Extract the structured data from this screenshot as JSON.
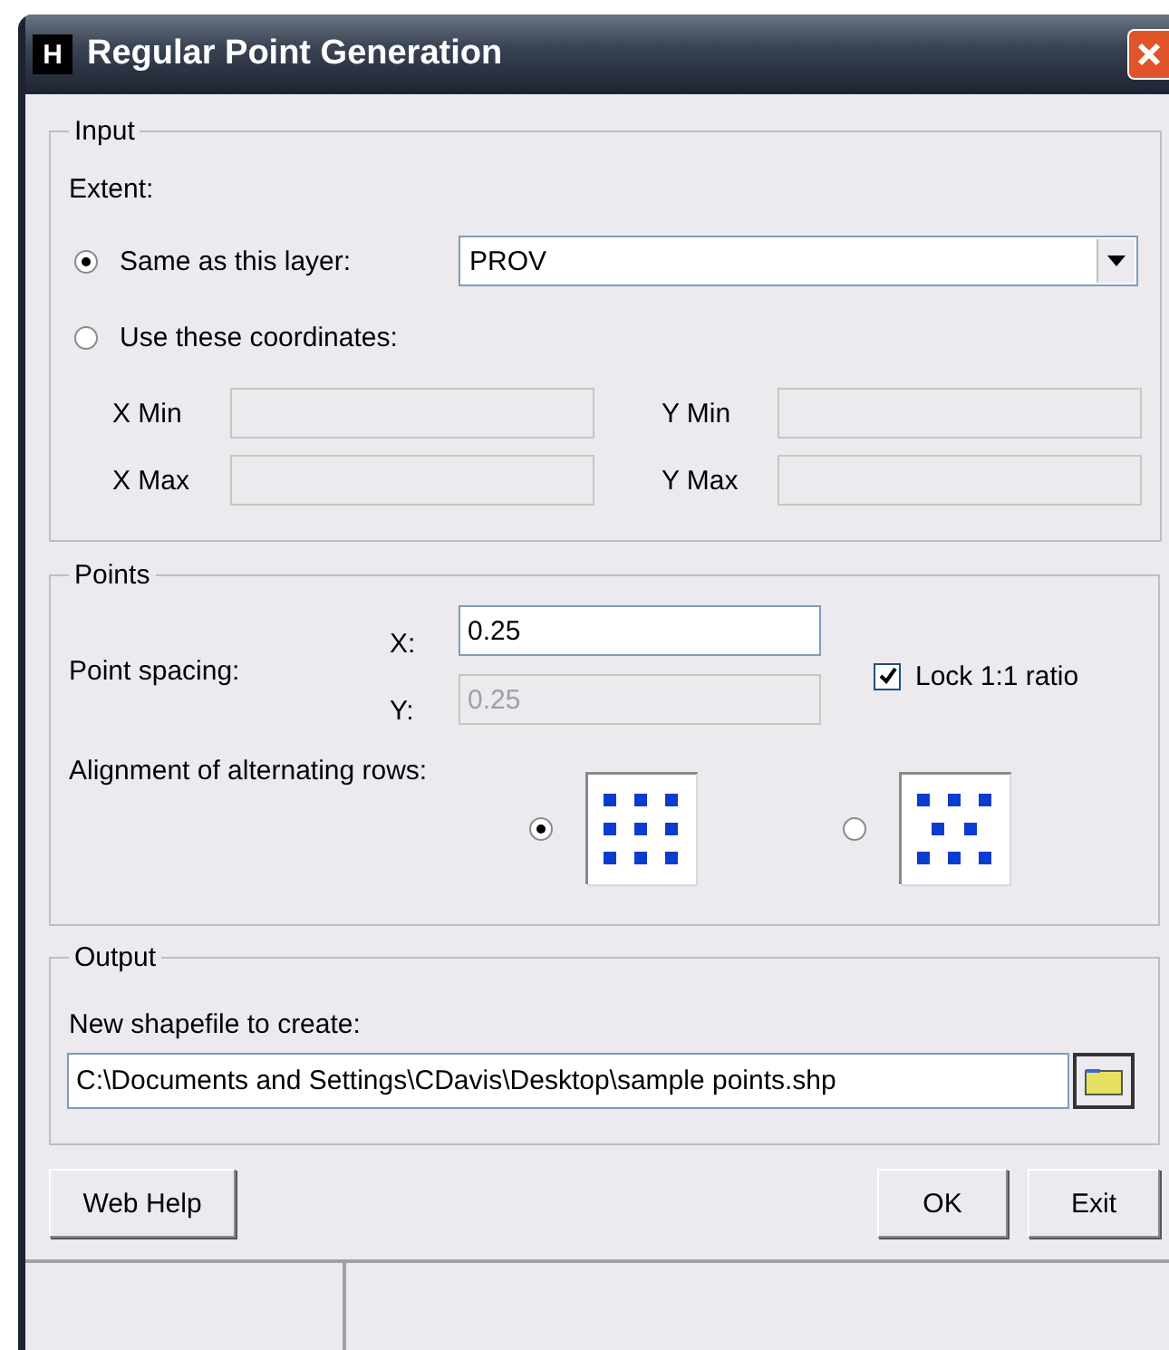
{
  "window": {
    "title": "Regular Point Generation",
    "app_icon_letter": "H"
  },
  "input": {
    "legend": "Input",
    "extent_label": "Extent:",
    "extent_options": [
      {
        "label": "Same as this layer:",
        "selected": true
      },
      {
        "label": "Use these coordinates:",
        "selected": false
      }
    ],
    "layer": {
      "value": "PROV"
    },
    "coordinates": [
      {
        "label": "X Min",
        "disabled": true
      },
      {
        "label": "Y Min",
        "disabled": true
      },
      {
        "label": "X Max",
        "disabled": true
      },
      {
        "label": "Y Max",
        "disabled": true
      }
    ]
  },
  "points": {
    "legend": "Points",
    "spacing_label": "Point spacing:",
    "spacing": [
      {
        "axis": "X:",
        "value": "0.25",
        "disabled": false
      },
      {
        "axis": "Y:",
        "value": "0.25",
        "disabled": true
      }
    ],
    "lock": {
      "label": "Lock 1:1 ratio",
      "checked": true
    },
    "alignment_label": "Alignment of alternating rows:",
    "alignment_options": [
      {
        "kind": "aligned",
        "selected": true
      },
      {
        "kind": "staggered",
        "selected": false
      }
    ]
  },
  "output": {
    "legend": "Output",
    "label": "New shapefile to create:",
    "path": "C:\\Documents and Settings\\CDavis\\Desktop\\sample points.shp"
  },
  "buttons": {
    "help": "Web Help",
    "ok": "OK",
    "exit": "Exit"
  }
}
